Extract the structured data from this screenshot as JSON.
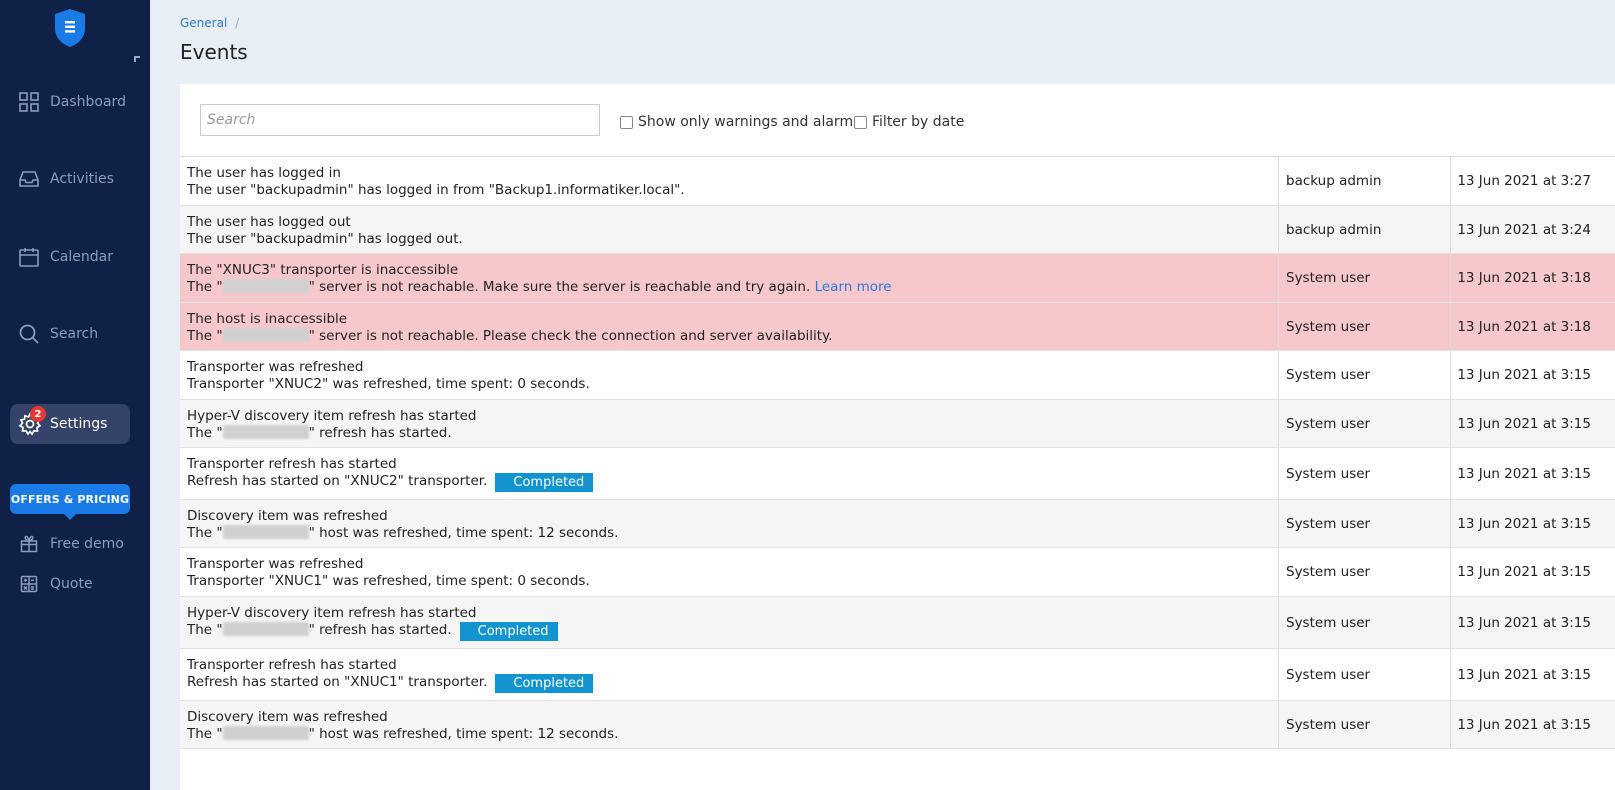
{
  "sidebar": {
    "items": [
      {
        "label": "Dashboard"
      },
      {
        "label": "Activities"
      },
      {
        "label": "Calendar"
      },
      {
        "label": "Search"
      },
      {
        "label": "Settings",
        "badge": "2"
      }
    ],
    "offers_label": "OFFERS & PRICING",
    "sub_items": [
      {
        "label": "Free demo"
      },
      {
        "label": "Quote"
      }
    ]
  },
  "breadcrumb": {
    "root": "General",
    "sep": "/"
  },
  "page": {
    "title": "Events"
  },
  "search": {
    "placeholder": "Search",
    "value": ""
  },
  "filters": {
    "warnings_label": "Show only warnings and alarms",
    "date_label": "Filter by date"
  },
  "events": [
    {
      "title": "The user has logged in",
      "detail": "The user \"backupadmin\" has logged in from \"Backup1.informatiker.local\".",
      "user": "backup admin",
      "date": "13 Jun 2021 at 3:27"
    },
    {
      "title": "The user has logged out",
      "detail": "The user \"backupadmin\" has logged out.",
      "user": "backup admin",
      "date": "13 Jun 2021 at 3:24"
    },
    {
      "title": "The \"XNUC3\" transporter is inaccessible",
      "detail_pre": "The \"",
      "detail_post": "\" server is not reachable. Make sure the server is reachable and try again.",
      "link": "Learn more",
      "user": "System user",
      "date": "13 Jun 2021 at 3:18"
    },
    {
      "title": "The host is inaccessible",
      "detail_pre": "The \"",
      "detail_post": "\" server is not reachable. Please check the connection and server availability.",
      "user": "System user",
      "date": "13 Jun 2021 at 3:18"
    },
    {
      "title": "Transporter was refreshed",
      "detail": "Transporter \"XNUC2\" was refreshed, time spent: 0 seconds.",
      "user": "System user",
      "date": "13 Jun 2021 at 3:15"
    },
    {
      "title": "Hyper-V discovery item refresh has started",
      "detail_pre": "The \"",
      "detail_post": "\" refresh has started.",
      "user": "System user",
      "date": "13 Jun 2021 at 3:15"
    },
    {
      "title": "Transporter refresh has started",
      "detail": "Refresh has started on \"XNUC2\" transporter.",
      "status": "Completed",
      "user": "System user",
      "date": "13 Jun 2021 at 3:15"
    },
    {
      "title": "Discovery item was refreshed",
      "detail_pre": "The \"",
      "detail_post": "\" host was refreshed, time spent: 12 seconds.",
      "user": "System user",
      "date": "13 Jun 2021 at 3:15"
    },
    {
      "title": "Transporter was refreshed",
      "detail": "Transporter \"XNUC1\" was refreshed, time spent: 0 seconds.",
      "user": "System user",
      "date": "13 Jun 2021 at 3:15"
    },
    {
      "title": "Hyper-V discovery item refresh has started",
      "detail_pre": "The \"",
      "detail_post": "\" refresh has started.",
      "status": "Completed",
      "user": "System user",
      "date": "13 Jun 2021 at 3:15"
    },
    {
      "title": "Transporter refresh has started",
      "detail": "Refresh has started on \"XNUC1\" transporter.",
      "status": "Completed",
      "user": "System user",
      "date": "13 Jun 2021 at 3:15"
    },
    {
      "title": "Discovery item was refreshed",
      "detail_pre": "The \"",
      "detail_post": "\" host was refreshed, time spent: 12 seconds.",
      "user": "System user",
      "date": "13 Jun 2021 at 3:15"
    }
  ],
  "colors": {
    "sidebar": "#0f2147",
    "accent": "#1a7ae6",
    "alarm_row": "#f6c8cc",
    "status": "#1294d0"
  }
}
